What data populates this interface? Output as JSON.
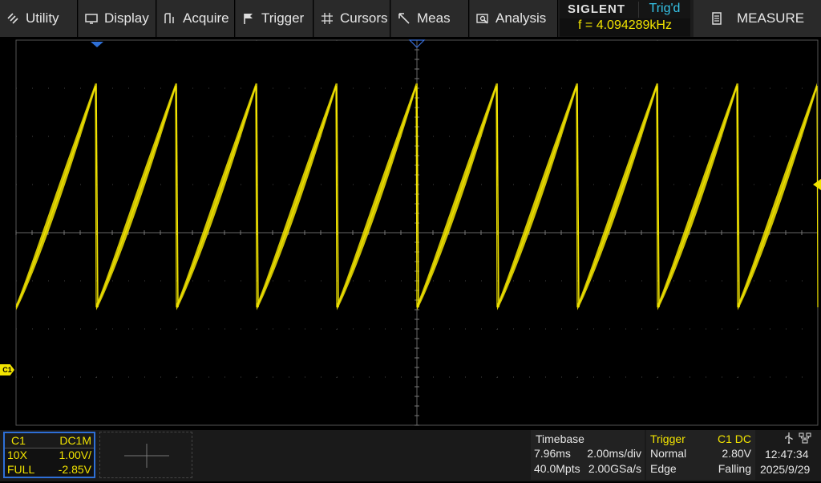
{
  "menu": [
    {
      "label": "Utility",
      "icon": "wrench-icon"
    },
    {
      "label": "Display",
      "icon": "monitor-icon"
    },
    {
      "label": "Acquire",
      "icon": "acquire-icon"
    },
    {
      "label": "Trigger",
      "icon": "flag-icon"
    },
    {
      "label": "Cursors",
      "icon": "crosshair-icon"
    },
    {
      "label": "Meas",
      "icon": "ruler-icon"
    },
    {
      "label": "Analysis",
      "icon": "analysis-icon"
    }
  ],
  "brand": "SIGLENT",
  "trigger_status": "Trig'd",
  "frequency": "f = 4.094289kHz",
  "measure_label": "MEASURE",
  "channel": {
    "name": "C1",
    "coupling": "DC1M",
    "probe": "10X",
    "scale": "1.00V/",
    "bandwidth": "FULL",
    "offset": "-2.85V",
    "marker": "C1"
  },
  "timebase": {
    "title": "Timebase",
    "delay": "7.96ms",
    "scale": "2.00ms/div",
    "memory": "40.0Mpts",
    "sample_rate": "2.00GSa/s"
  },
  "trigger": {
    "title": "Trigger",
    "source": "C1 DC",
    "mode": "Normal",
    "level": "2.80V",
    "type": "Edge",
    "slope": "Falling"
  },
  "clock": {
    "time": "12:47:34",
    "date": "2025/9/29"
  },
  "colors": {
    "trace": "#f2e400",
    "accent": "#2e6fd6",
    "trigcolor": "#35c4e8"
  },
  "chart_data": {
    "type": "line",
    "title": "",
    "xlabel": "",
    "ylabel": "",
    "xlim": [
      -10,
      10
    ],
    "ylim": [
      -5,
      3
    ],
    "period_divs": 2.0,
    "wave": "sawtooth-rising",
    "y_min": -2.55,
    "y_max": 2.1
  }
}
